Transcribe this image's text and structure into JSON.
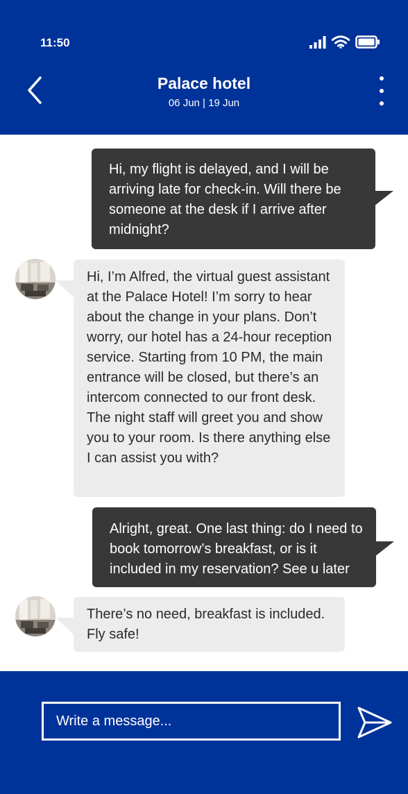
{
  "status_bar": {
    "time": "11:50",
    "icons": [
      "signal-icon",
      "wifi-icon",
      "battery-icon"
    ]
  },
  "header": {
    "title": "Palace hotel",
    "dates": "06 Jun | 19 Jun",
    "back_icon": "chevron-left-icon",
    "menu_icon": "more-vertical-icon"
  },
  "messages": [
    {
      "sender": "user",
      "text": "Hi, my flight is delayed, and I will be arriving late for check-in.  Will there be someone at the desk if I arrive after midnight?"
    },
    {
      "sender": "assistant",
      "text": "Hi, I’m Alfred, the virtual guest assistant at the Palace Hotel! I’m sorry to hear about the change in your plans. Don’t worry, our hotel has a 24-hour reception service. Starting from 10 PM, the main entrance will be closed, but there’s an intercom connected to our front desk. The night staff will greet you and show you to your room. Is there anything else I can assist you with?"
    },
    {
      "sender": "user",
      "text": "Alright, great. One last thing: do I need to book tomorrow’s breakfast, or is it included in my reservation? See u later"
    },
    {
      "sender": "assistant",
      "text": "There’s no need, breakfast is included. Fly safe!"
    }
  ],
  "composer": {
    "placeholder": "Write a message...",
    "send_icon": "send-icon"
  },
  "colors": {
    "brand_blue": "#003399",
    "user_bubble": "#383838",
    "assistant_bubble": "#ececec",
    "background": "#ffffff"
  }
}
